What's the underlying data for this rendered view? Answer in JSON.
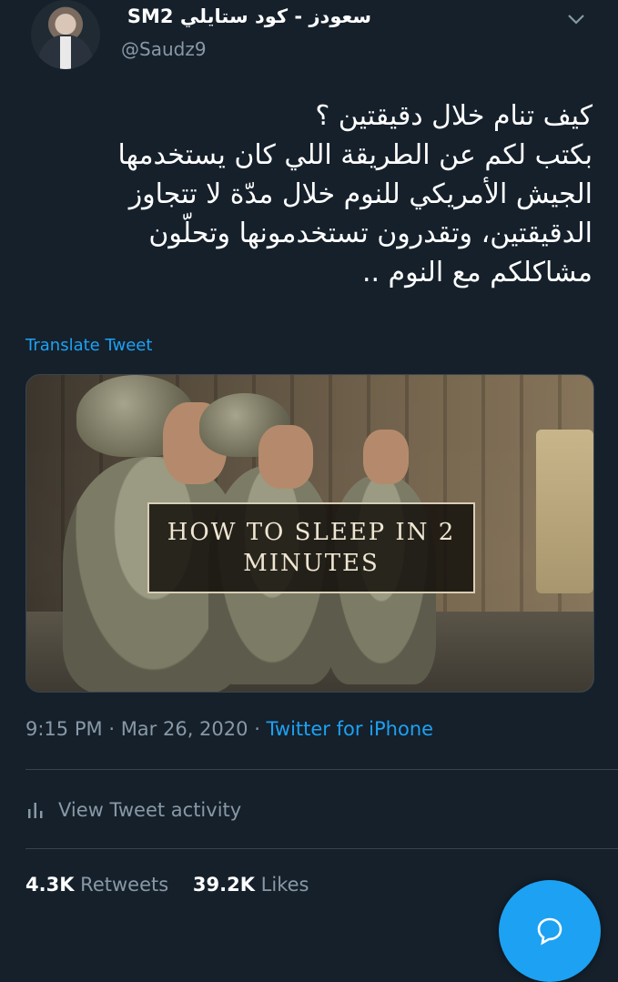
{
  "author": {
    "display_name": "سعودز - كود ستايلي SM2",
    "handle": "@Saudz9"
  },
  "tweet": {
    "lines": [
      "كيف تنام خلال دقيقتين ؟",
      "بكتب لكم عن الطريقة اللي كان يستخدمها",
      "الجيش الأمريكي للنوم خلال مدّة لا تتجاوز",
      "الدقيقتين، وتقدرون تستخدمونها وتحلّون",
      "مشاكلكم مع النوم .."
    ],
    "translate_label": "Translate Tweet",
    "media": {
      "caption_line1": "HOW TO SLEEP IN 2",
      "caption_line2": "MINUTES"
    },
    "time": "9:15 PM",
    "date": "Mar 26, 2020",
    "separator": "·",
    "source": "Twitter for iPhone"
  },
  "activity": {
    "label": "View Tweet activity",
    "icon": "bar-chart-icon"
  },
  "stats": {
    "retweets_count": "4.3K",
    "retweets_label": "Retweets",
    "likes_count": "39.2K",
    "likes_label": "Likes"
  },
  "fab": {
    "icon": "reply-icon"
  },
  "colors": {
    "background": "#15202b",
    "accent": "#1da1f2",
    "muted": "#8899a6",
    "divider": "#38444d"
  }
}
